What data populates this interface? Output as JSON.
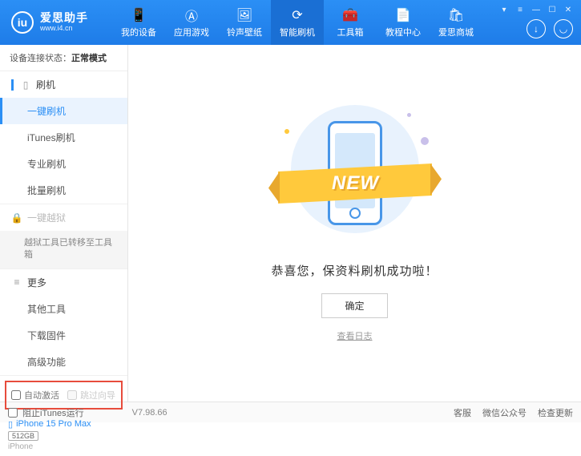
{
  "app": {
    "title": "爱思助手",
    "url": "www.i4.cn"
  },
  "nav": [
    {
      "label": "我的设备",
      "icon": "📱"
    },
    {
      "label": "应用游戏",
      "icon": "Ⓐ"
    },
    {
      "label": "铃声壁纸",
      "icon": "🖼"
    },
    {
      "label": "智能刷机",
      "icon": "⟳",
      "active": true
    },
    {
      "label": "工具箱",
      "icon": "🧰"
    },
    {
      "label": "教程中心",
      "icon": "📄"
    },
    {
      "label": "爱思商城",
      "icon": "🛍"
    }
  ],
  "deviceStatus": {
    "label": "设备连接状态：",
    "value": "正常模式"
  },
  "sidebar": {
    "flash": {
      "title": "刷机",
      "items": [
        "一键刷机",
        "iTunes刷机",
        "专业刷机",
        "批量刷机"
      ],
      "activeIndex": 0
    },
    "jailbreak": {
      "title": "一键越狱",
      "note": "越狱工具已转移至工具箱"
    },
    "more": {
      "title": "更多",
      "items": [
        "其他工具",
        "下载固件",
        "高级功能"
      ]
    }
  },
  "checkboxes": {
    "autoActivate": "自动激活",
    "skipGuide": "跳过向导"
  },
  "device": {
    "name": "iPhone 15 Pro Max",
    "storage": "512GB",
    "type": "iPhone"
  },
  "main": {
    "ribbonText": "NEW",
    "successText": "恭喜您，保资料刷机成功啦！",
    "okButton": "确定",
    "logLink": "查看日志"
  },
  "footer": {
    "blockItunes": "阻止iTunes运行",
    "version": "V7.98.66",
    "links": [
      "客服",
      "微信公众号",
      "检查更新"
    ]
  }
}
